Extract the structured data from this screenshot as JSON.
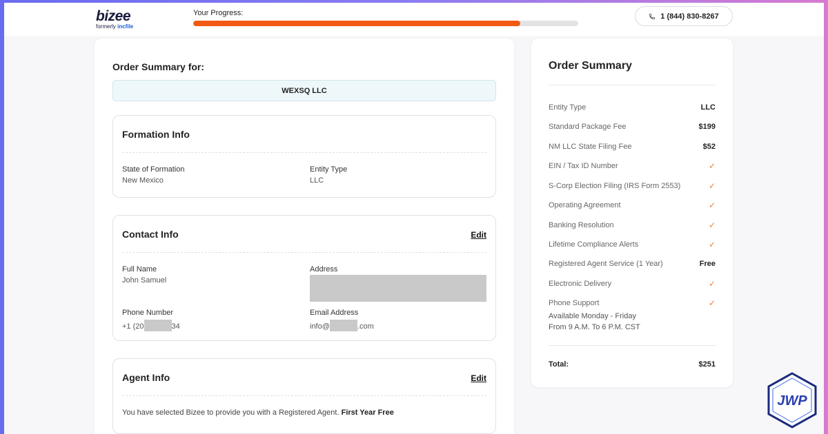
{
  "brand": {
    "logo": "bizee",
    "formerly_prefix": "formerly",
    "formerly_name": "incfile"
  },
  "progress": {
    "label": "Your Progress:",
    "fraction": 0.85
  },
  "phone": {
    "icon": "phone-icon",
    "number": "1 (844) 830-8267"
  },
  "left": {
    "summary_for": "Order Summary for:",
    "company_name": "WEXSQ LLC",
    "formation": {
      "title": "Formation Info",
      "state_label": "State of Formation",
      "state_value": "New Mexico",
      "entity_label": "Entity Type",
      "entity_value": "LLC"
    },
    "contact": {
      "title": "Contact Info",
      "edit": "Edit",
      "name_label": "Full Name",
      "name_value": "John Samuel",
      "address_label": "Address",
      "phone_label": "Phone Number",
      "phone_prefix": "+1 (20",
      "phone_suffix": "34",
      "email_label": "Email Address",
      "email_prefix": "info@",
      "email_suffix": ".com"
    },
    "agent": {
      "title": "Agent Info",
      "edit": "Edit",
      "text": "You have selected Bizee to provide you with a Registered Agent.",
      "highlight": "First Year Free"
    }
  },
  "right": {
    "title": "Order Summary",
    "items": [
      {
        "label": "Entity Type",
        "value": "LLC"
      },
      {
        "label": "Standard Package Fee",
        "value": "$199"
      },
      {
        "label": "NM LLC State Filing Fee",
        "value": "$52"
      },
      {
        "label": "EIN / Tax ID Number",
        "value": "✓"
      },
      {
        "label": "S-Corp Election Filing (IRS Form 2553)",
        "value": "✓"
      },
      {
        "label": "Operating Agreement",
        "value": "✓"
      },
      {
        "label": "Banking Resolution",
        "value": "✓"
      },
      {
        "label": "Lifetime Compliance Alerts",
        "value": "✓"
      },
      {
        "label": "Registered Agent Service (1 Year)",
        "value": "Free"
      },
      {
        "label": "Electronic Delivery",
        "value": "✓"
      },
      {
        "label": "Phone Support",
        "value": "✓"
      }
    ],
    "support_hours_1": "Available Monday - Friday",
    "support_hours_2": "From 9 A.M. To 6 P.M. CST",
    "total_label": "Total:",
    "total_value": "$251"
  },
  "badge": {
    "text": "JWP"
  },
  "colors": {
    "accent": "#f25a14",
    "check": "#f07a3a",
    "company_bg": "#eef8fb",
    "brand_blue": "#1e5bd8"
  }
}
